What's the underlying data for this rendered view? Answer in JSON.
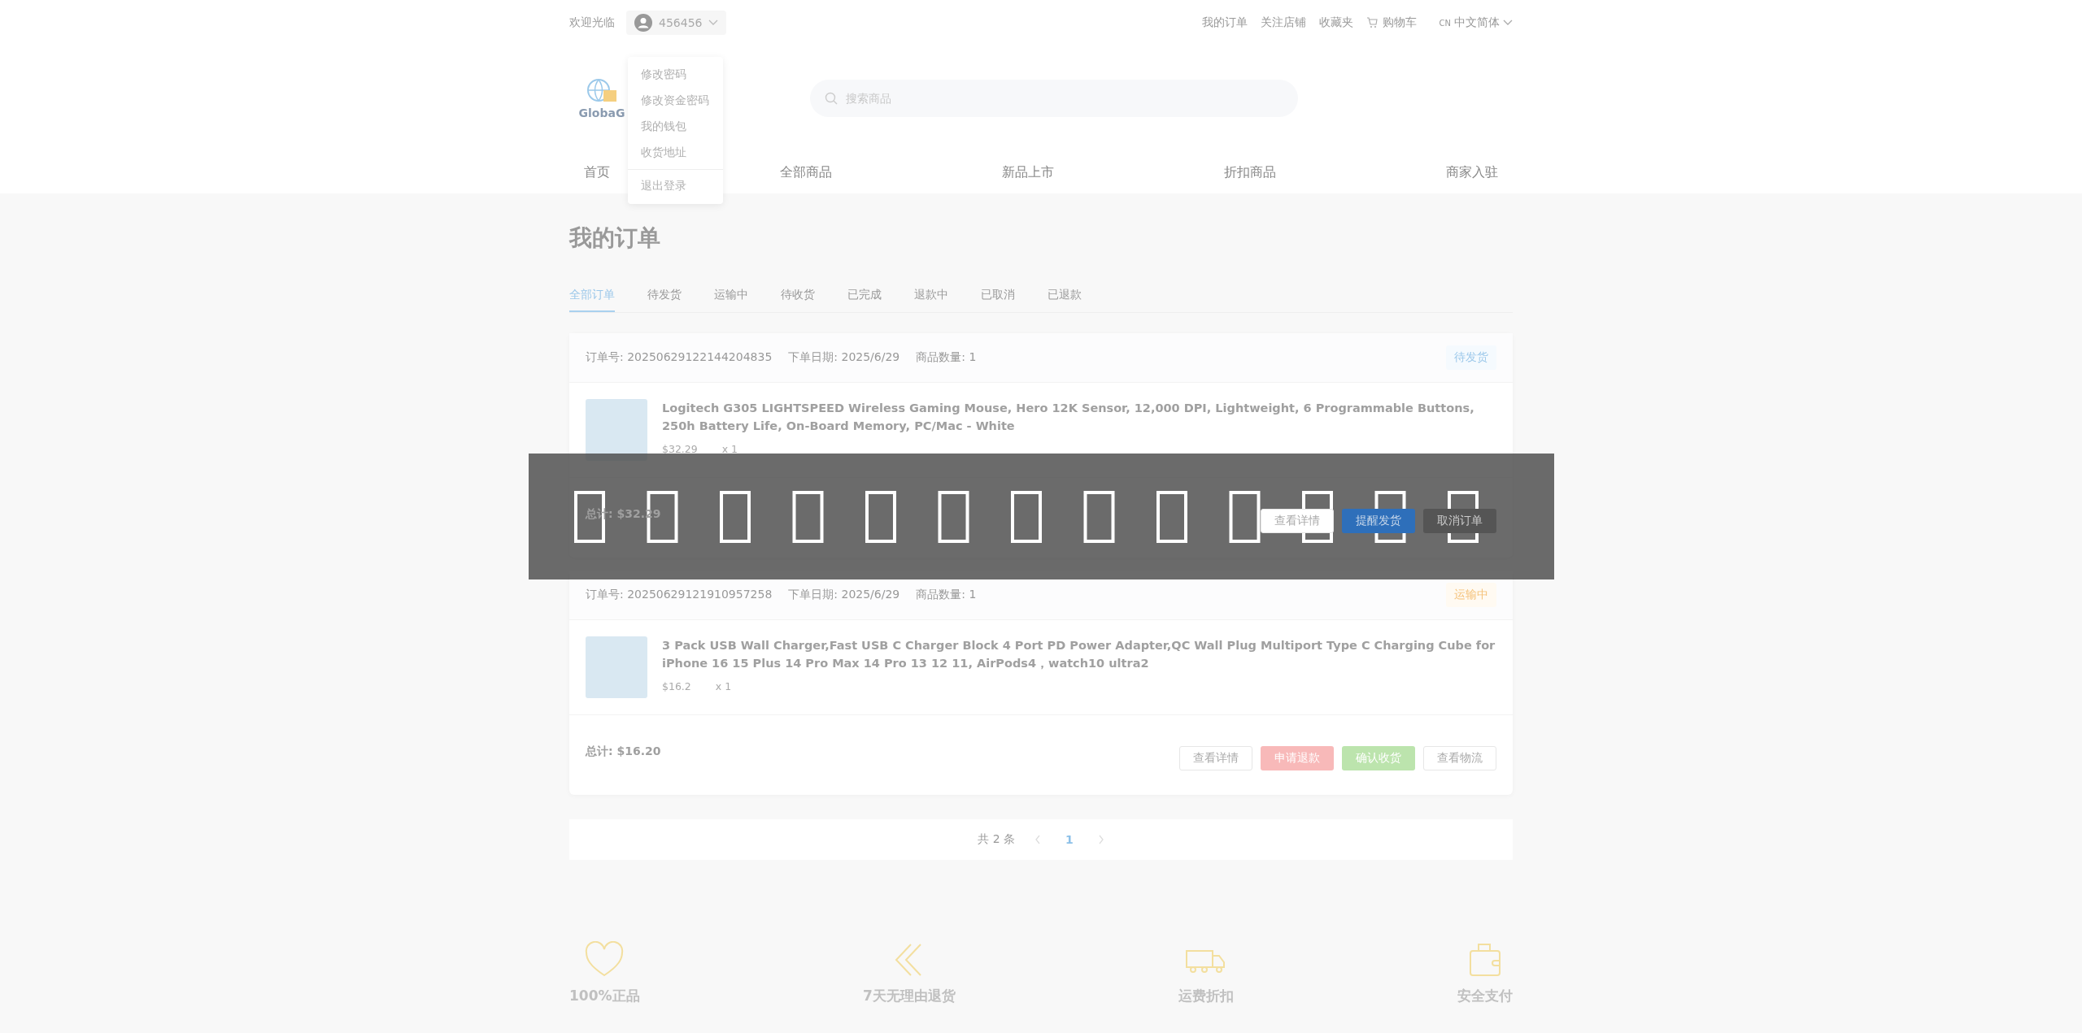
{
  "top_bar": {
    "welcome": "欢迎光临",
    "username": "456456",
    "links": [
      {
        "label": "我的订单"
      },
      {
        "label": "关注店铺"
      },
      {
        "label": "收藏夹"
      }
    ],
    "cart": "购物车",
    "language": {
      "code": "CN",
      "label": "中文简体"
    }
  },
  "user_menu": {
    "items": [
      "修改密码",
      "修改资金密码",
      "我的钱包",
      "收货地址"
    ],
    "logout": "退出登录"
  },
  "logo": {
    "text": "GlobaG"
  },
  "search": {
    "placeholder": "搜索商品"
  },
  "nav": [
    "首页",
    "全部商品",
    "新品上市",
    "折扣商品",
    "商家入驻"
  ],
  "page_title": "我的订单",
  "tabs": [
    {
      "label": "全部订单",
      "selected": true
    },
    {
      "label": "待发货",
      "selected": false
    },
    {
      "label": "运输中",
      "selected": false
    },
    {
      "label": "待收货",
      "selected": false
    },
    {
      "label": "已完成",
      "selected": false
    },
    {
      "label": "退款中",
      "selected": false
    },
    {
      "label": "已取消",
      "selected": false
    },
    {
      "label": "已退款",
      "selected": false
    }
  ],
  "orders": [
    {
      "meta": [
        "订单号: 20250629122144204835",
        "下单日期: 2025/6/29",
        "商品数量: 1"
      ],
      "status": {
        "label": "待发货",
        "kind": "pending"
      },
      "items": [
        {
          "title": "Logitech G305 LIGHTSPEED Wireless Gaming Mouse, Hero 12K Sensor, 12,000 DPI, Lightweight, 6 Programmable Buttons, 250h Battery Life, On-Board Memory, PC/Mac - White",
          "price": "$32.29",
          "qty": "x 1"
        }
      ],
      "total": "总计: $32.29",
      "actions": [
        {
          "label": "查看详情",
          "kind": "outline"
        },
        {
          "label": "提醒发货",
          "kind": "primary"
        },
        {
          "label": "取消订单",
          "kind": "dark"
        }
      ]
    },
    {
      "meta": [
        "订单号: 20250629121910957258",
        "下单日期: 2025/6/29",
        "商品数量: 1"
      ],
      "status": {
        "label": "运输中",
        "kind": "shipping"
      },
      "items": [
        {
          "title": "3 Pack USB Wall Charger,Fast USB C Charger Block 4 Port PD Power Adapter,QC Wall Plug Multiport Type C Charging Cube for iPhone 16 15 Plus 14 Pro Max 14 Pro 13 12 11, AirPods4，watch10 ultra2",
          "price": "$16.2",
          "qty": "x 1"
        }
      ],
      "total": "总计: $16.20",
      "actions": [
        {
          "label": "查看详情",
          "kind": "outline"
        },
        {
          "label": "申请退款",
          "kind": "danger"
        },
        {
          "label": "确认收货",
          "kind": "success"
        },
        {
          "label": "查看物流",
          "kind": "outline"
        }
      ]
    }
  ],
  "pagination": {
    "total": "共 2 条",
    "pages": [
      {
        "label": "1",
        "selected": true
      }
    ]
  },
  "toast": {
    "visible": true
  },
  "features": [
    {
      "label": "100%正品",
      "kind": "heart"
    },
    {
      "label": "7天无理由退货",
      "kind": "return"
    },
    {
      "label": "运费折扣",
      "kind": "truck"
    },
    {
      "label": "安全支付",
      "kind": "wallet"
    }
  ]
}
